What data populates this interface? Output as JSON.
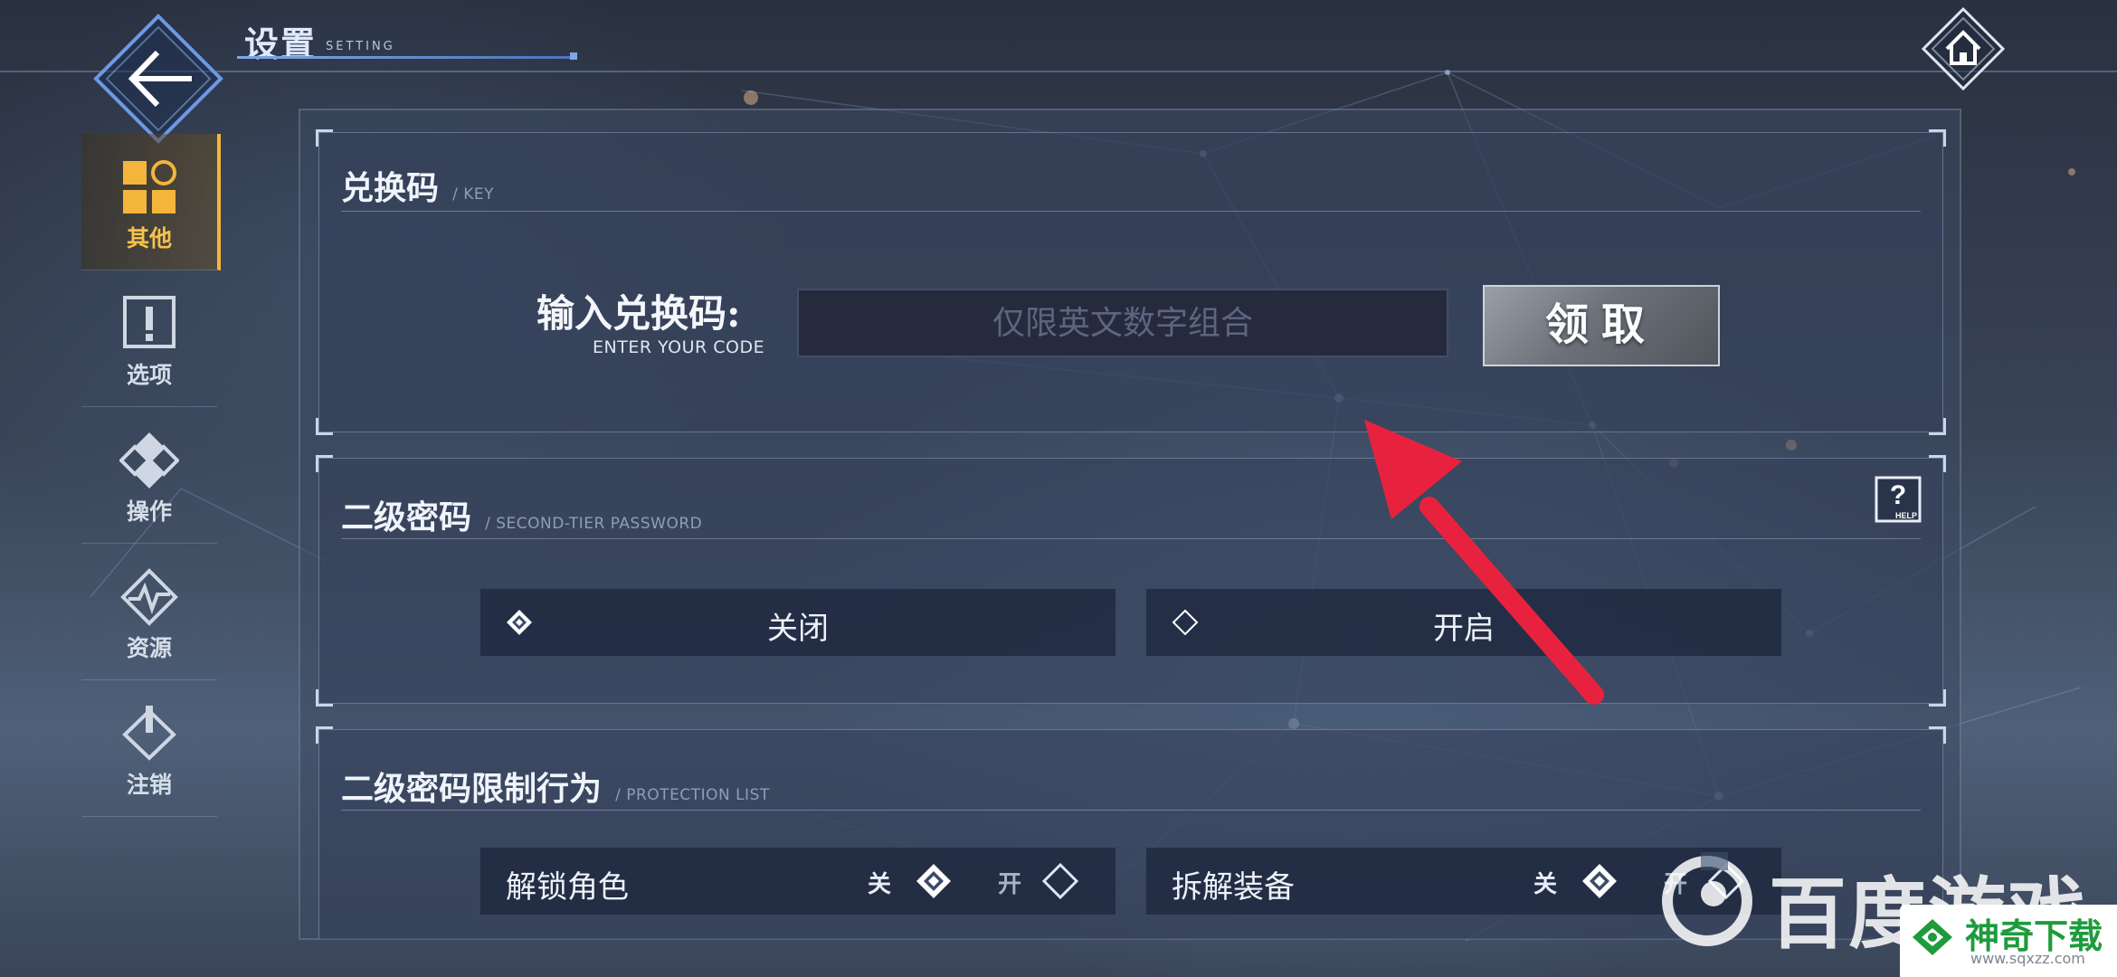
{
  "header": {
    "title": "设置",
    "subtitle": "SETTING"
  },
  "sidebar": {
    "items": [
      {
        "label": "其他",
        "icon": "grid-circle-icon",
        "active": true
      },
      {
        "label": "选项",
        "icon": "exclamation-icon",
        "active": false
      },
      {
        "label": "操作",
        "icon": "diamond-cluster-icon",
        "active": false
      },
      {
        "label": "资源",
        "icon": "pulse-diamond-icon",
        "active": false
      },
      {
        "label": "注销",
        "icon": "power-icon",
        "active": false
      }
    ]
  },
  "redeem": {
    "title": "兑换码",
    "subtitle": "/ KEY",
    "input_label": "输入兑换码:",
    "input_sublabel": "ENTER YOUR CODE",
    "placeholder": "仅限英文数字组合",
    "value": "",
    "claim_label": "领取"
  },
  "second_password": {
    "title": "二级密码",
    "subtitle": "/ SECOND-TIER PASSWORD",
    "help_label": "HELP",
    "options": [
      {
        "label": "关闭",
        "selected": true
      },
      {
        "label": "开启",
        "selected": false
      }
    ]
  },
  "protection": {
    "title": "二级密码限制行为",
    "subtitle": "/ PROTECTION LIST",
    "off_label": "关",
    "on_label": "开",
    "items": [
      {
        "label": "解锁角色",
        "state": "off"
      },
      {
        "label": "拆解装备",
        "state": "off"
      }
    ]
  },
  "watermarks": {
    "baidu": "百度游戏",
    "sqxz": "神奇下载",
    "sqxz_url": "www.sqxzz.com"
  },
  "colors": {
    "accent_gold": "#f3b53a",
    "accent_blue": "#7fa6e6",
    "arrow_red": "#e8223e"
  }
}
